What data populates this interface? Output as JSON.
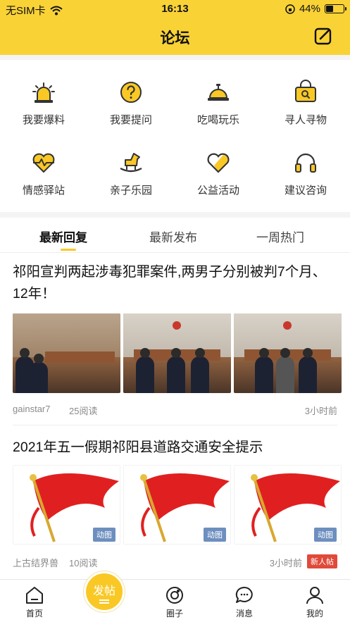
{
  "status_bar": {
    "carrier": "无SIM卡",
    "time": "16:13",
    "battery": "44%",
    "battery_level": 0.44
  },
  "nav": {
    "title": "论坛"
  },
  "categories": [
    {
      "label": "我要爆料",
      "icon": "siren-icon"
    },
    {
      "label": "我要提问",
      "icon": "question-icon"
    },
    {
      "label": "吃喝玩乐",
      "icon": "food-bell-icon"
    },
    {
      "label": "寻人寻物",
      "icon": "search-bag-icon"
    },
    {
      "label": "情感驿站",
      "icon": "heart-pulse-icon"
    },
    {
      "label": "亲子乐园",
      "icon": "rocking-horse-icon"
    },
    {
      "label": "公益活动",
      "icon": "heart-band-icon"
    },
    {
      "label": "建议咨询",
      "icon": "headphones-icon"
    }
  ],
  "tabs": [
    {
      "label": "最新回复",
      "active": true
    },
    {
      "label": "最新发布",
      "active": false
    },
    {
      "label": "一周热门",
      "active": false
    }
  ],
  "posts": [
    {
      "title": "祁阳宣判两起涉毒犯罪案件,两男子分别被判7个月、12年！",
      "author": "gainstar7",
      "reads": "25阅读",
      "time": "3小时前"
    },
    {
      "title": "2021年五一假期祁阳县道路交通安全提示",
      "author": "上古结界兽",
      "reads": "10阅读",
      "time": "3小时前",
      "gif_badge": "动图",
      "new_badge": "新人帖"
    }
  ],
  "bottom_nav": {
    "home": "首页",
    "post": "发帖",
    "circle": "圈子",
    "messages": "消息",
    "mine": "我的"
  },
  "colors": {
    "accent": "#f9d236",
    "new_badge": "#e04a3a",
    "gif_badge": "#6d8fbf"
  }
}
